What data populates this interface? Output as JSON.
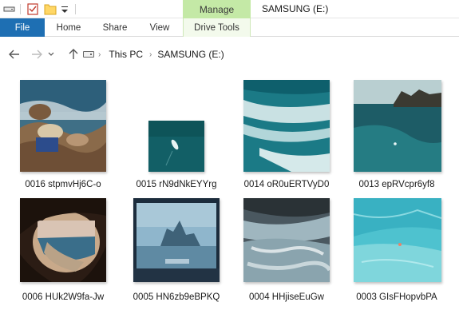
{
  "titlebar": {
    "context_tab": "Manage",
    "title": "SAMSUNG (E:)"
  },
  "ribbon": {
    "tabs": [
      "File",
      "Home",
      "Share",
      "View",
      "Drive Tools"
    ]
  },
  "address": {
    "crumbs": [
      "This PC",
      "SAMSUNG (E:)"
    ]
  },
  "files": [
    {
      "name": "0016 stpmvHj6C-o"
    },
    {
      "name": "0015 rN9dNkEYYrg"
    },
    {
      "name": "0014 oR0uERTVyD0"
    },
    {
      "name": "0013 epRVcpr6yf8"
    },
    {
      "name": "0006 HUk2W9fa-Jw"
    },
    {
      "name": "0005 HN6zb9eBPKQ"
    },
    {
      "name": "0004 HHjiseEuGw"
    },
    {
      "name": "0003 GIsFHopvbPA"
    }
  ],
  "colors": {
    "file_tab": "#1e6fb3",
    "manage_tab": "#c4e9a6"
  }
}
